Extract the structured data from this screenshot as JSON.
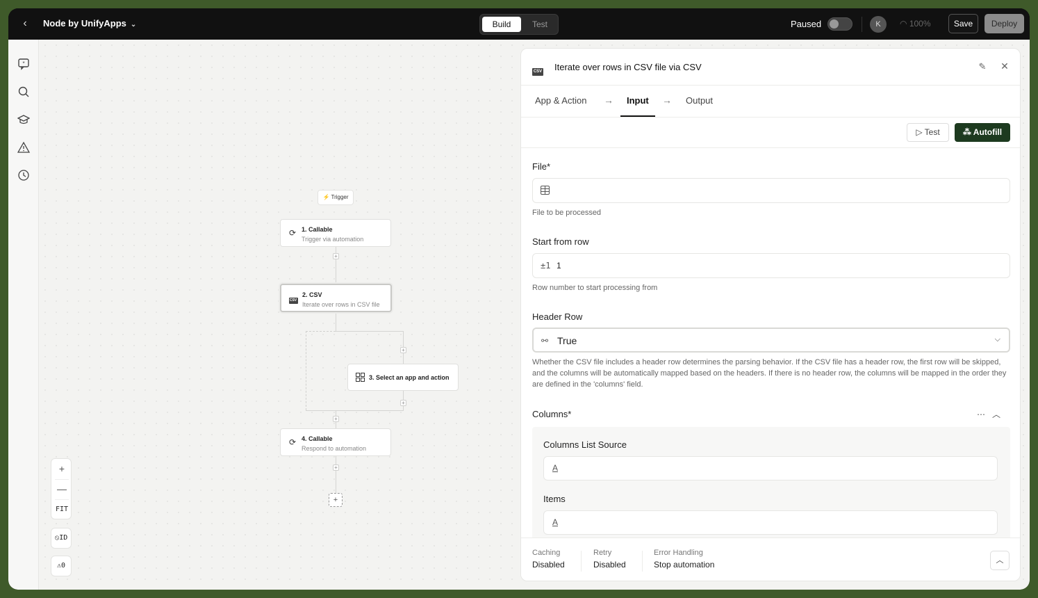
{
  "topbar": {
    "back_icon": "chevron-left-icon",
    "app_title": "Node by UnifyApps",
    "modes": {
      "build": "Build",
      "test": "Test"
    },
    "paused_label": "Paused",
    "avatar_initial": "K",
    "zoom_readout": "100%",
    "save_label": "Save",
    "deploy_label": "Deploy"
  },
  "leftrail": {
    "icons": [
      "ai-chat-icon",
      "search-icon",
      "learn-icon",
      "warning-icon",
      "history-icon"
    ]
  },
  "canvas": {
    "zoom_controls": {
      "zoom_in": "+",
      "zoom_out": "—",
      "fit": "FIT"
    },
    "id_toggle": "ID",
    "warning_count": "0",
    "trigger_label": "Trigger",
    "nodes": [
      {
        "title": "1. Callable",
        "subtitle": "Trigger via automation"
      },
      {
        "title": "2. CSV",
        "subtitle": "Iterate over rows in CSV file"
      },
      {
        "title": "3. Select an app and action",
        "subtitle": ""
      },
      {
        "title": "4. Callable",
        "subtitle": "Respond to automation"
      }
    ],
    "csv_badge": "CSV"
  },
  "panel": {
    "title": "Iterate over rows in CSV file via CSV",
    "tabs": [
      "App & Action",
      "Input",
      "Output"
    ],
    "active_tab": "Input",
    "test_label": "Test",
    "autofill_label": "Autofill",
    "fields": {
      "file": {
        "label": "File*",
        "value": "",
        "help": "File to be processed"
      },
      "start_row": {
        "label": "Start from row",
        "icon_text": "±1",
        "value": "1",
        "help": "Row number to start processing from"
      },
      "header_row": {
        "label": "Header Row",
        "value": "True",
        "help": "Whether the CSV file includes a header row determines the parsing behavior. If the CSV file has a header row, the first row will be skipped, and the columns will be automatically mapped based on the headers. If there is no header row, the columns will be mapped in the order they are defined in the 'columns' field."
      },
      "columns": {
        "label": "Columns*",
        "list_source_label": "Columns List Source",
        "items_label": "Items",
        "input_icon_text": "A"
      }
    },
    "footer": {
      "caching": {
        "label": "Caching",
        "value": "Disabled"
      },
      "retry": {
        "label": "Retry",
        "value": "Disabled"
      },
      "error_handling": {
        "label": "Error Handling",
        "value": "Stop automation"
      }
    }
  }
}
